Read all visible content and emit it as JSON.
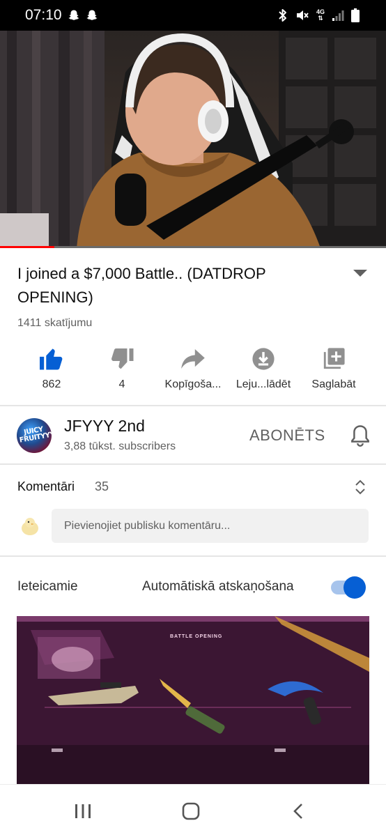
{
  "status_bar": {
    "time": "07:10",
    "left_icons": [
      "snapchat-icon",
      "snapchat-icon"
    ],
    "right_icons": [
      "bluetooth-icon",
      "mute-icon",
      "network-4g-icon",
      "signal-icon",
      "battery-icon"
    ],
    "network_label": "4G"
  },
  "video": {
    "progress_fraction": 0.14,
    "progress_color": "#ff0000"
  },
  "video_info": {
    "title": "I joined a $7,000 Battle.. (DATDROP OPENING)",
    "views": "1411 skatījumu"
  },
  "actions": [
    {
      "icon": "thumbs-up-icon",
      "label": "862",
      "active_color": "#065fd4"
    },
    {
      "icon": "thumbs-down-icon",
      "label": "4"
    },
    {
      "icon": "share-icon",
      "label": "Kopīgoša..."
    },
    {
      "icon": "download-icon",
      "label": "Leju...lādēt"
    },
    {
      "icon": "save-to-playlist-icon",
      "label": "Saglabāt"
    }
  ],
  "channel": {
    "avatar_text": "JUICY FRUITYYY",
    "name": "JFYYY 2nd",
    "subscribers": "3,88 tūkst. subscribers",
    "subscribe_label": "ABONĒTS"
  },
  "comments": {
    "title": "Komentāri",
    "count": "35",
    "input_placeholder": "Pievienojiet publisku komentāru..."
  },
  "recommended": {
    "title": "Ieteicamie",
    "autoplay_label": "Automātiskā atskaņošana",
    "autoplay_on": true,
    "thumbnail_text": "BATTLE OPENING"
  },
  "nav_bar": {
    "icons": [
      "recent-apps-icon",
      "home-icon",
      "back-icon"
    ]
  },
  "colors": {
    "accent_blue": "#065fd4",
    "text_primary": "#0f0f0f",
    "text_secondary": "#606060",
    "icon_grey": "#909090"
  }
}
